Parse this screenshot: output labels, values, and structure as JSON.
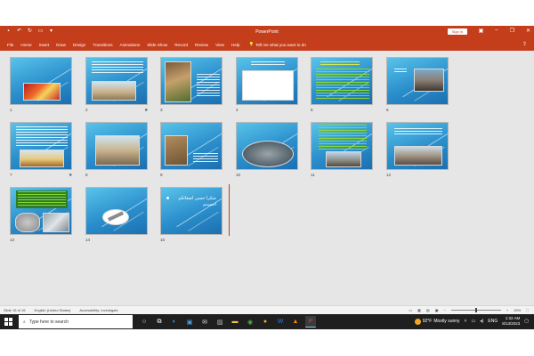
{
  "app": {
    "title": "PowerPoint",
    "signin_label": "Sign in",
    "accent": "#c43e1c"
  },
  "ribbon": {
    "tabs": [
      "File",
      "Home",
      "Insert",
      "Draw",
      "Design",
      "Transitions",
      "Animations",
      "Slide Show",
      "Record",
      "Review",
      "View",
      "Help"
    ],
    "tell_me": "Tell me what you want to do"
  },
  "slides": [
    {
      "number": "1"
    },
    {
      "number": "2",
      "star": "★"
    },
    {
      "number": "3"
    },
    {
      "number": "4"
    },
    {
      "number": "5"
    },
    {
      "number": "6"
    },
    {
      "number": "7",
      "star": "★"
    },
    {
      "number": "8"
    },
    {
      "number": "9"
    },
    {
      "number": "10"
    },
    {
      "number": "11"
    },
    {
      "number": "12"
    },
    {
      "number": "13"
    },
    {
      "number": "14"
    },
    {
      "number": "15",
      "title_line1": "شكرا حسن اصغائكم",
      "title_line2": "احسنتم"
    }
  ],
  "status": {
    "slide_counter": "Slide 15 of 15",
    "language": "English (United States)",
    "accessibility": "Accessibility: Investigate",
    "zoom": "15%"
  },
  "taskbar": {
    "search_placeholder": "Type here to search",
    "weather_temp": "92°F",
    "weather_desc": "Mostly sunny",
    "time": "1:32 AM",
    "date": "8/13/2023",
    "lang": "ENG"
  }
}
